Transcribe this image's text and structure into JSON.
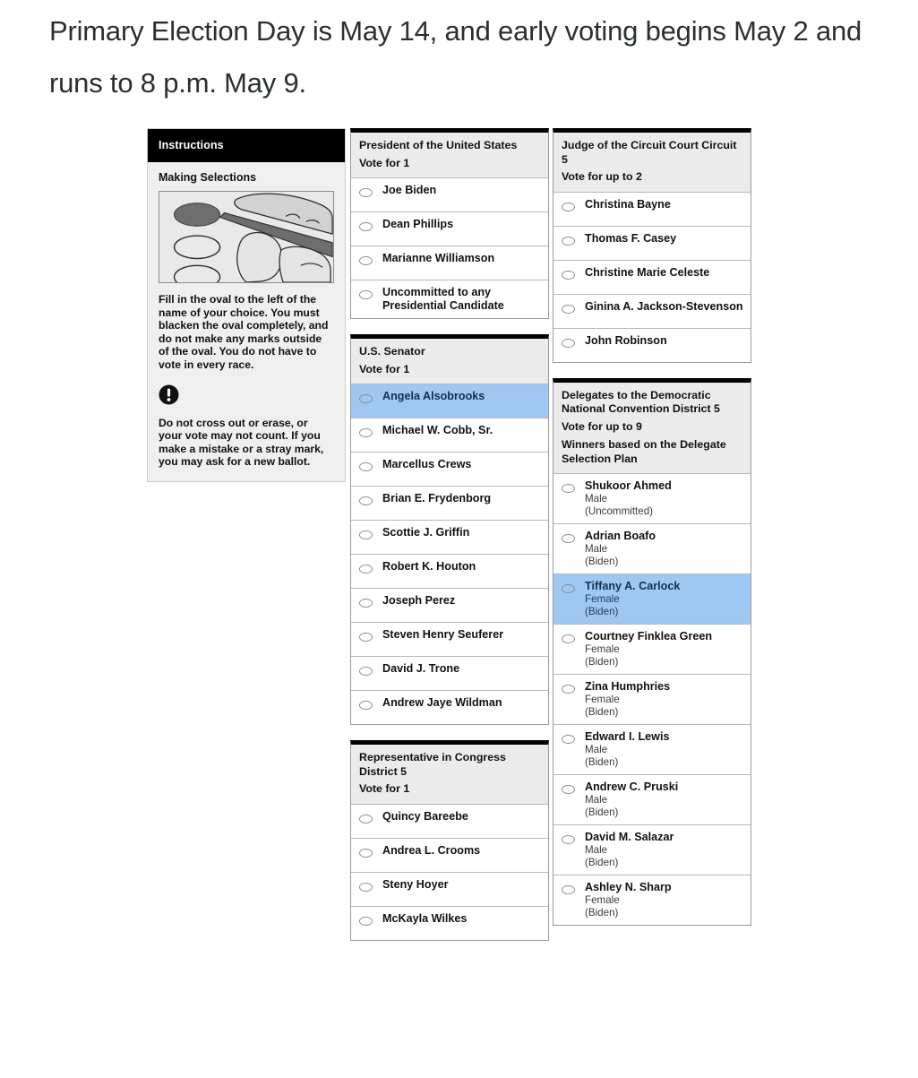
{
  "headline": "Primary Election Day is May 14, and early voting begins May 2 and runs to 8 p.m. May 9.",
  "colors": {
    "selection_highlight": "#9ec7f2",
    "contest_header_bg": "#ebebeb",
    "instructions_header_bg": "#000000",
    "page_bg": "#ffffff"
  },
  "instructions": {
    "header": "Instructions",
    "subhead": "Making Selections",
    "figure_alt": "hand-marking-oval-illustration",
    "paragraph1": "Fill in the oval to the left of the name of your choice. You must blacken the oval completely, and do not make any marks outside of the oval. You do not have to vote in every race.",
    "warning_icon": "exclamation-circle-icon",
    "paragraph2": "Do not cross out or erase, or your vote may not count. If you make a mistake or a stray mark, you may ask for a new ballot."
  },
  "contests": [
    {
      "id": "president",
      "title": "President of the United States",
      "instruction": "Vote for 1",
      "note": "",
      "options": [
        {
          "name": "Joe Biden",
          "meta": [],
          "selected": false
        },
        {
          "name": "Dean Phillips",
          "meta": [],
          "selected": false
        },
        {
          "name": "Marianne Williamson",
          "meta": [],
          "selected": false
        },
        {
          "name": "Uncommitted to any Presidential Candidate",
          "meta": [],
          "selected": false
        }
      ]
    },
    {
      "id": "us-senator",
      "title": "U.S. Senator",
      "instruction": "Vote for 1",
      "note": "",
      "options": [
        {
          "name": "Angela Alsobrooks",
          "meta": [],
          "selected": true
        },
        {
          "name": "Michael W. Cobb, Sr.",
          "meta": [],
          "selected": false
        },
        {
          "name": "Marcellus Crews",
          "meta": [],
          "selected": false
        },
        {
          "name": "Brian E. Frydenborg",
          "meta": [],
          "selected": false
        },
        {
          "name": "Scottie J. Griffin",
          "meta": [],
          "selected": false
        },
        {
          "name": "Robert K. Houton",
          "meta": [],
          "selected": false
        },
        {
          "name": "Joseph Perez",
          "meta": [],
          "selected": false
        },
        {
          "name": "Steven Henry Seuferer",
          "meta": [],
          "selected": false
        },
        {
          "name": "David J. Trone",
          "meta": [],
          "selected": false
        },
        {
          "name": "Andrew Jaye Wildman",
          "meta": [],
          "selected": false
        }
      ]
    },
    {
      "id": "representative-in-congress",
      "title": "Representative in Congress District 5",
      "instruction": "Vote for 1",
      "note": "",
      "options": [
        {
          "name": "Quincy Bareebe",
          "meta": [],
          "selected": false
        },
        {
          "name": "Andrea L. Crooms",
          "meta": [],
          "selected": false
        },
        {
          "name": "Steny Hoyer",
          "meta": [],
          "selected": false
        },
        {
          "name": "McKayla Wilkes",
          "meta": [],
          "selected": false
        }
      ]
    },
    {
      "id": "judge-circuit-court",
      "title": "Judge of the Circuit Court Circuit 5",
      "instruction": "Vote for up to 2",
      "note": "",
      "options": [
        {
          "name": "Christina Bayne",
          "meta": [],
          "selected": false
        },
        {
          "name": "Thomas F. Casey",
          "meta": [],
          "selected": false
        },
        {
          "name": "Christine Marie Celeste",
          "meta": [],
          "selected": false
        },
        {
          "name": "Ginina A. Jackson-Stevenson",
          "meta": [],
          "selected": false
        },
        {
          "name": "John Robinson",
          "meta": [],
          "selected": false
        }
      ]
    },
    {
      "id": "delegates-dnc",
      "title": "Delegates to the Democratic National Convention District 5",
      "instruction": "Vote for up to 9",
      "note": "Winners based on the Delegate Selection Plan",
      "options": [
        {
          "name": "Shukoor Ahmed",
          "meta": [
            "Male",
            "(Uncommitted)"
          ],
          "selected": false
        },
        {
          "name": "Adrian Boafo",
          "meta": [
            "Male",
            "(Biden)"
          ],
          "selected": false
        },
        {
          "name": "Tiffany A. Carlock",
          "meta": [
            "Female",
            "(Biden)"
          ],
          "selected": true
        },
        {
          "name": "Courtney Finklea Green",
          "meta": [
            "Female",
            "(Biden)"
          ],
          "selected": false
        },
        {
          "name": "Zina Humphries",
          "meta": [
            "Female",
            "(Biden)"
          ],
          "selected": false
        },
        {
          "name": "Edward I. Lewis",
          "meta": [
            "Male",
            "(Biden)"
          ],
          "selected": false
        },
        {
          "name": "Andrew C. Pruski",
          "meta": [
            "Male",
            "(Biden)"
          ],
          "selected": false
        },
        {
          "name": "David M. Salazar",
          "meta": [
            "Male",
            "(Biden)"
          ],
          "selected": false
        },
        {
          "name": "Ashley N. Sharp",
          "meta": [
            "Female",
            "(Biden)"
          ],
          "selected": false
        }
      ]
    }
  ],
  "column_layout": {
    "column1": [
      "instructions"
    ],
    "column2": [
      "president",
      "us-senator",
      "representative-in-congress"
    ],
    "column3": [
      "judge-circuit-court",
      "delegates-dnc"
    ]
  }
}
